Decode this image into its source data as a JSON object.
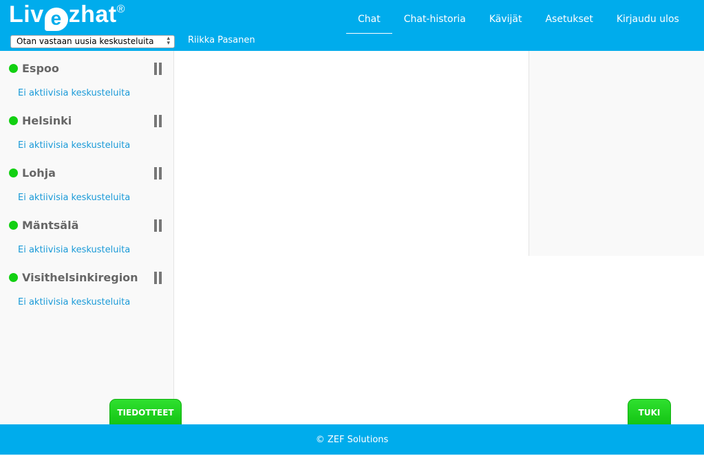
{
  "header": {
    "logo": "Livezhat",
    "status_select": "Otan vastaan uusia keskusteluita",
    "user": "Riikka Pasanen",
    "nav": [
      {
        "label": "Chat",
        "active": true
      },
      {
        "label": "Chat-historia"
      },
      {
        "label": "Kävijät"
      },
      {
        "label": "Asetukset"
      },
      {
        "label": "Kirjaudu ulos"
      }
    ]
  },
  "sidebar": {
    "groups": [
      {
        "name": "Espoo",
        "status": "no chats",
        "online": true
      },
      {
        "name": "Helsinki",
        "status": "no chats",
        "online": true
      },
      {
        "name": "Lohja",
        "status": "no chats",
        "online": true
      },
      {
        "name": "Mäntsälä",
        "status": "no chats",
        "online": true
      },
      {
        "name": "Visithelsinkiregion",
        "status": "no chats",
        "online": true
      }
    ],
    "empty_text": "Ei aktiivisia keskusteluita"
  },
  "buttons": {
    "news": "TIEDOTTEET",
    "support": "TUKI"
  },
  "footer": {
    "text": "© ZEF Solutions"
  },
  "colors": {
    "brand": "#00acec",
    "online": "#12d012",
    "link": "#1a9ad8"
  }
}
